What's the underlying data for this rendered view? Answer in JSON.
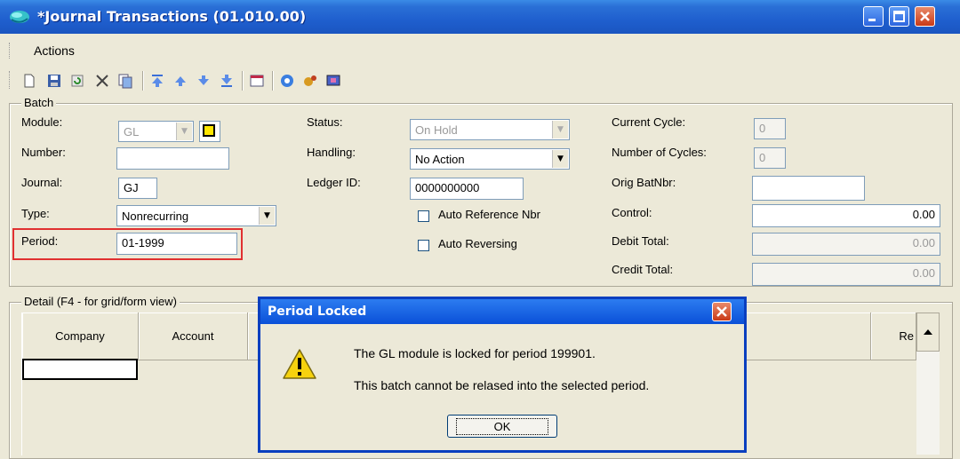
{
  "window": {
    "title": "*Journal Transactions (01.010.00)"
  },
  "menu": {
    "actions": "Actions"
  },
  "toolbar": {
    "icons": [
      "new-icon",
      "save-icon",
      "refresh-icon",
      "delete-icon",
      "copy-icon",
      "first-icon",
      "previous-icon",
      "next-icon",
      "last-icon",
      "window-icon",
      "help-icon",
      "tools-icon",
      "screen-icon"
    ]
  },
  "batch": {
    "group_label": "Batch",
    "module_label": "Module:",
    "module_value": "GL",
    "number_label": "Number:",
    "number_value": "",
    "journal_label": "Journal:",
    "journal_value": "GJ",
    "type_label": "Type:",
    "type_value": "Nonrecurring",
    "period_label": "Period:",
    "period_value": "01-1999",
    "status_label": "Status:",
    "status_value": "On Hold",
    "handling_label": "Handling:",
    "handling_value": "No Action",
    "ledger_label": "Ledger ID:",
    "ledger_value": "0000000000",
    "auto_ref_label": "Auto Reference Nbr",
    "auto_rev_label": "Auto Reversing",
    "current_cycle_label": "Current Cycle:",
    "current_cycle_value": "0",
    "num_cycles_label": "Number of Cycles:",
    "num_cycles_value": "0",
    "orig_bat_label": "Orig BatNbr:",
    "orig_bat_value": "",
    "control_label": "Control:",
    "control_value": "0.00",
    "debit_label": "Debit Total:",
    "debit_value": "0.00",
    "credit_label": "Credit Total:",
    "credit_value": "0.00"
  },
  "detail": {
    "group_label": "Detail (F4 - for grid/form view)",
    "columns": [
      "Company",
      "Account",
      "Re"
    ]
  },
  "dialog": {
    "title": "Period Locked",
    "message1": "The GL module is locked for period 199901.",
    "message2": "This batch cannot be relased into the selected period.",
    "ok_label": "OK"
  },
  "colors": {
    "titlebar": "#2a6fd6",
    "highlight_border": "#e03030",
    "window_bg": "#ece9d8"
  }
}
